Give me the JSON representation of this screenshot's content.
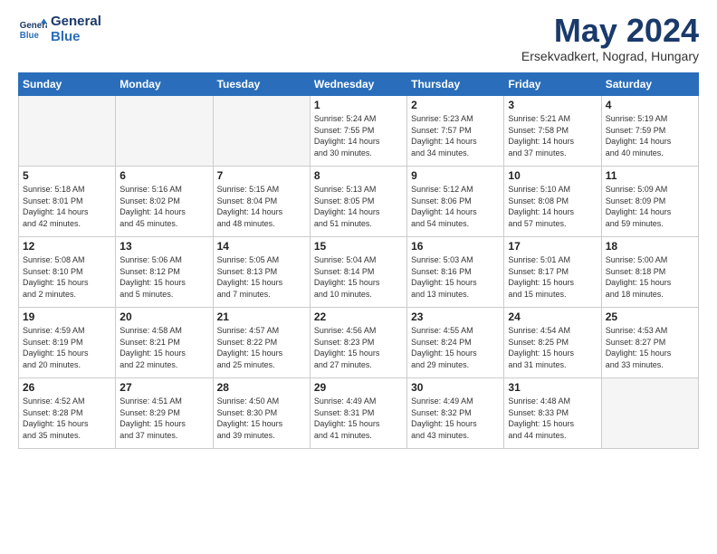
{
  "logo": {
    "line1": "General",
    "line2": "Blue"
  },
  "title": "May 2024",
  "location": "Ersekvadkert, Nograd, Hungary",
  "days_of_week": [
    "Sunday",
    "Monday",
    "Tuesday",
    "Wednesday",
    "Thursday",
    "Friday",
    "Saturday"
  ],
  "weeks": [
    [
      {
        "day": "",
        "info": ""
      },
      {
        "day": "",
        "info": ""
      },
      {
        "day": "",
        "info": ""
      },
      {
        "day": "1",
        "info": "Sunrise: 5:24 AM\nSunset: 7:55 PM\nDaylight: 14 hours\nand 30 minutes."
      },
      {
        "day": "2",
        "info": "Sunrise: 5:23 AM\nSunset: 7:57 PM\nDaylight: 14 hours\nand 34 minutes."
      },
      {
        "day": "3",
        "info": "Sunrise: 5:21 AM\nSunset: 7:58 PM\nDaylight: 14 hours\nand 37 minutes."
      },
      {
        "day": "4",
        "info": "Sunrise: 5:19 AM\nSunset: 7:59 PM\nDaylight: 14 hours\nand 40 minutes."
      }
    ],
    [
      {
        "day": "5",
        "info": "Sunrise: 5:18 AM\nSunset: 8:01 PM\nDaylight: 14 hours\nand 42 minutes."
      },
      {
        "day": "6",
        "info": "Sunrise: 5:16 AM\nSunset: 8:02 PM\nDaylight: 14 hours\nand 45 minutes."
      },
      {
        "day": "7",
        "info": "Sunrise: 5:15 AM\nSunset: 8:04 PM\nDaylight: 14 hours\nand 48 minutes."
      },
      {
        "day": "8",
        "info": "Sunrise: 5:13 AM\nSunset: 8:05 PM\nDaylight: 14 hours\nand 51 minutes."
      },
      {
        "day": "9",
        "info": "Sunrise: 5:12 AM\nSunset: 8:06 PM\nDaylight: 14 hours\nand 54 minutes."
      },
      {
        "day": "10",
        "info": "Sunrise: 5:10 AM\nSunset: 8:08 PM\nDaylight: 14 hours\nand 57 minutes."
      },
      {
        "day": "11",
        "info": "Sunrise: 5:09 AM\nSunset: 8:09 PM\nDaylight: 14 hours\nand 59 minutes."
      }
    ],
    [
      {
        "day": "12",
        "info": "Sunrise: 5:08 AM\nSunset: 8:10 PM\nDaylight: 15 hours\nand 2 minutes."
      },
      {
        "day": "13",
        "info": "Sunrise: 5:06 AM\nSunset: 8:12 PM\nDaylight: 15 hours\nand 5 minutes."
      },
      {
        "day": "14",
        "info": "Sunrise: 5:05 AM\nSunset: 8:13 PM\nDaylight: 15 hours\nand 7 minutes."
      },
      {
        "day": "15",
        "info": "Sunrise: 5:04 AM\nSunset: 8:14 PM\nDaylight: 15 hours\nand 10 minutes."
      },
      {
        "day": "16",
        "info": "Sunrise: 5:03 AM\nSunset: 8:16 PM\nDaylight: 15 hours\nand 13 minutes."
      },
      {
        "day": "17",
        "info": "Sunrise: 5:01 AM\nSunset: 8:17 PM\nDaylight: 15 hours\nand 15 minutes."
      },
      {
        "day": "18",
        "info": "Sunrise: 5:00 AM\nSunset: 8:18 PM\nDaylight: 15 hours\nand 18 minutes."
      }
    ],
    [
      {
        "day": "19",
        "info": "Sunrise: 4:59 AM\nSunset: 8:19 PM\nDaylight: 15 hours\nand 20 minutes."
      },
      {
        "day": "20",
        "info": "Sunrise: 4:58 AM\nSunset: 8:21 PM\nDaylight: 15 hours\nand 22 minutes."
      },
      {
        "day": "21",
        "info": "Sunrise: 4:57 AM\nSunset: 8:22 PM\nDaylight: 15 hours\nand 25 minutes."
      },
      {
        "day": "22",
        "info": "Sunrise: 4:56 AM\nSunset: 8:23 PM\nDaylight: 15 hours\nand 27 minutes."
      },
      {
        "day": "23",
        "info": "Sunrise: 4:55 AM\nSunset: 8:24 PM\nDaylight: 15 hours\nand 29 minutes."
      },
      {
        "day": "24",
        "info": "Sunrise: 4:54 AM\nSunset: 8:25 PM\nDaylight: 15 hours\nand 31 minutes."
      },
      {
        "day": "25",
        "info": "Sunrise: 4:53 AM\nSunset: 8:27 PM\nDaylight: 15 hours\nand 33 minutes."
      }
    ],
    [
      {
        "day": "26",
        "info": "Sunrise: 4:52 AM\nSunset: 8:28 PM\nDaylight: 15 hours\nand 35 minutes."
      },
      {
        "day": "27",
        "info": "Sunrise: 4:51 AM\nSunset: 8:29 PM\nDaylight: 15 hours\nand 37 minutes."
      },
      {
        "day": "28",
        "info": "Sunrise: 4:50 AM\nSunset: 8:30 PM\nDaylight: 15 hours\nand 39 minutes."
      },
      {
        "day": "29",
        "info": "Sunrise: 4:49 AM\nSunset: 8:31 PM\nDaylight: 15 hours\nand 41 minutes."
      },
      {
        "day": "30",
        "info": "Sunrise: 4:49 AM\nSunset: 8:32 PM\nDaylight: 15 hours\nand 43 minutes."
      },
      {
        "day": "31",
        "info": "Sunrise: 4:48 AM\nSunset: 8:33 PM\nDaylight: 15 hours\nand 44 minutes."
      },
      {
        "day": "",
        "info": ""
      }
    ]
  ]
}
